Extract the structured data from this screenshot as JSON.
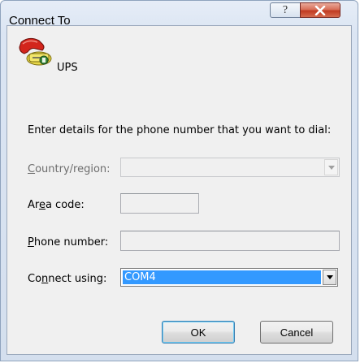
{
  "window": {
    "title": "Connect To",
    "help_glyph": "?",
    "close_glyph": "x"
  },
  "connection": {
    "icon": "phone-connection-icon",
    "name": "UPS"
  },
  "instruction": "Enter details for the phone number that you want to dial:",
  "country": {
    "label_pre": "",
    "label_ul": "C",
    "label_post": "ountry/region:",
    "value": "",
    "enabled": false
  },
  "area": {
    "label_pre": "Ar",
    "label_ul": "e",
    "label_post": "a code:",
    "value": "",
    "enabled": false
  },
  "phone": {
    "label_pre": "",
    "label_ul": "P",
    "label_post": "hone number:",
    "value": "",
    "enabled": false
  },
  "connect_using": {
    "label_pre": "Co",
    "label_ul": "n",
    "label_post": "nect using:",
    "value": "COM4"
  },
  "buttons": {
    "ok": "OK",
    "cancel": "Cancel"
  },
  "colors": {
    "selection": "#3399ff",
    "close_button": "#c13a22",
    "dialog_face": "#f0f0f0"
  }
}
